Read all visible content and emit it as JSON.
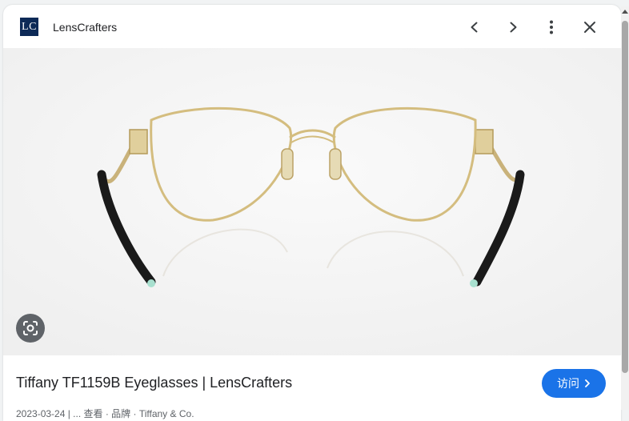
{
  "header": {
    "logo_text": "LC",
    "site_name": "LensCrafters",
    "icons": [
      "chevron-left-icon",
      "chevron-right-icon",
      "more-vert-icon",
      "close-icon"
    ]
  },
  "image": {
    "subject": "eyeglasses"
  },
  "lens_icon": "google-lens-icon",
  "result": {
    "title": "Tiffany TF1159B Eyeglasses | LensCrafters",
    "visit_label": "访问",
    "meta_text": "2023-03-24 | ... 查看 · 品牌 · Tiffany & Co."
  },
  "colors": {
    "accent": "#1a73e8",
    "logo_bg": "#0d2a57"
  }
}
